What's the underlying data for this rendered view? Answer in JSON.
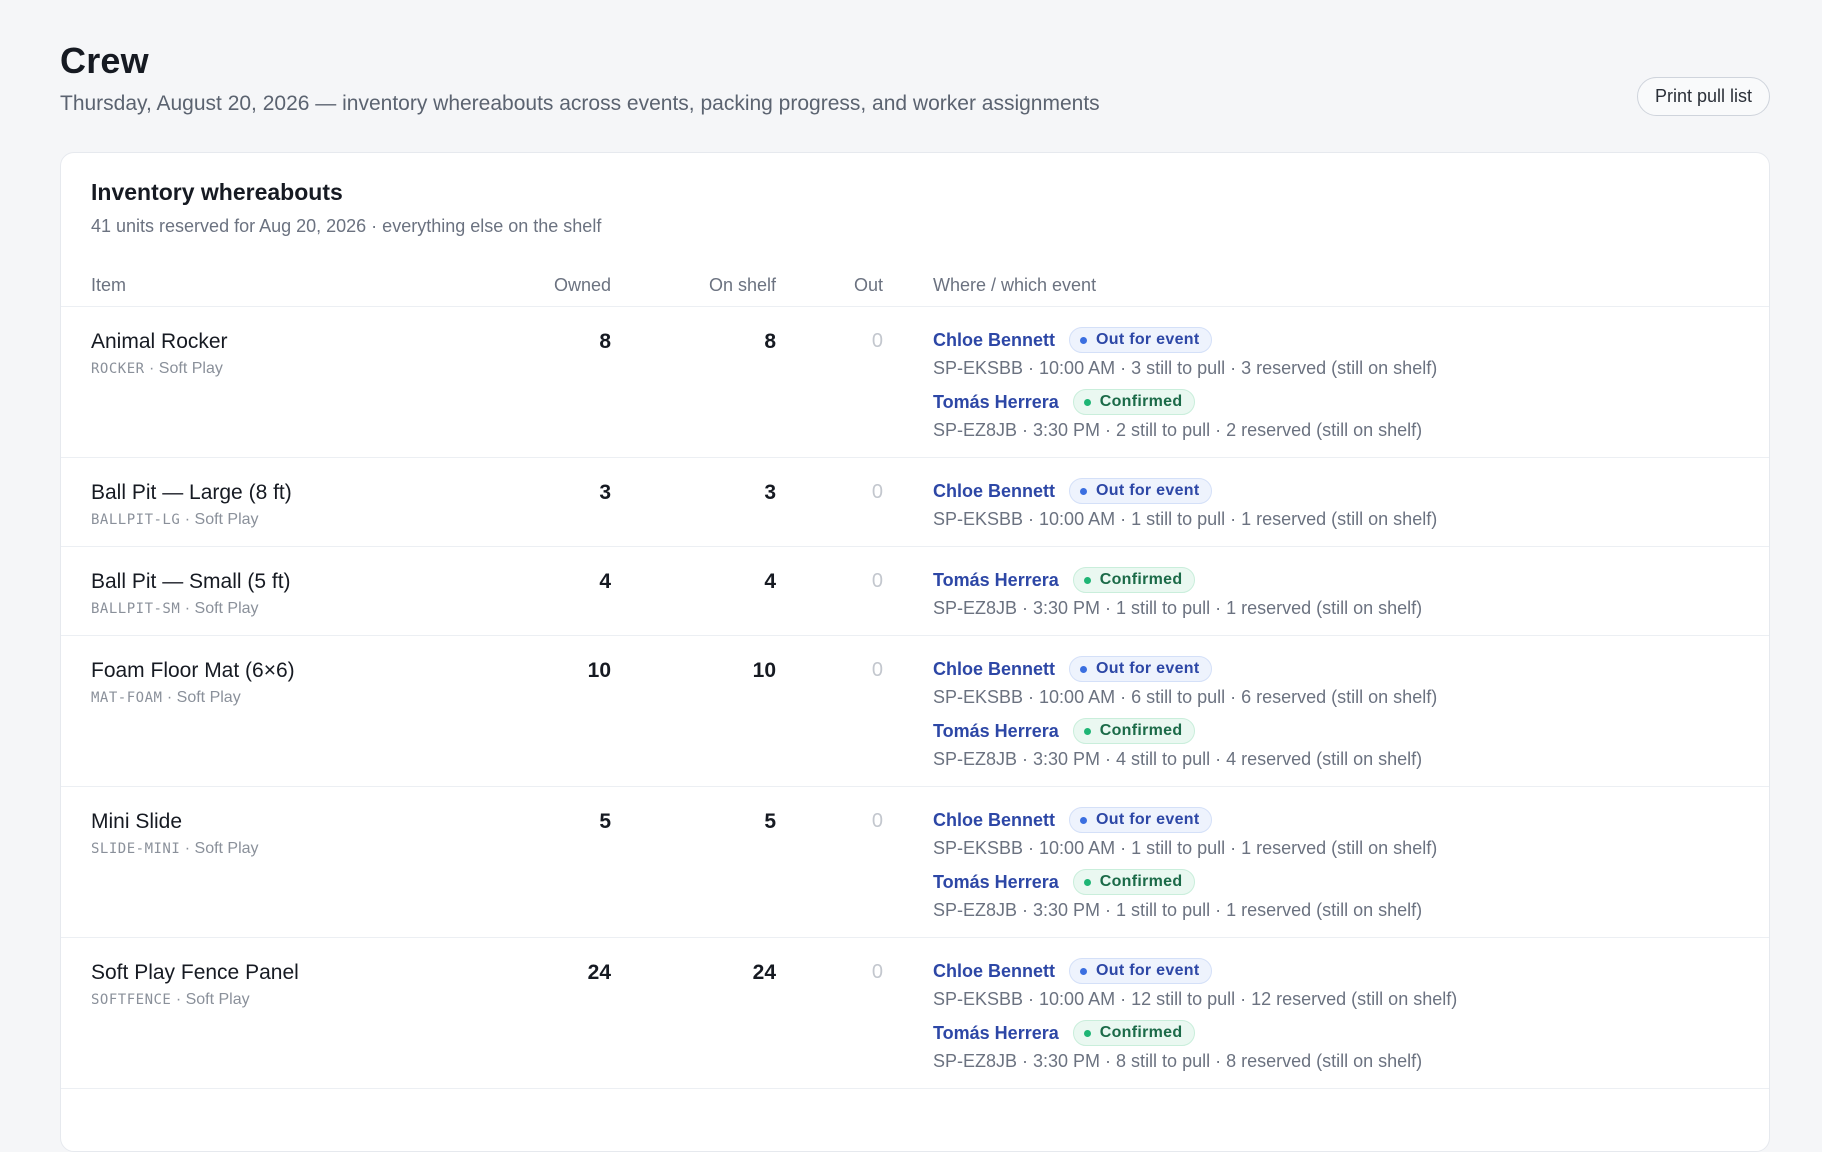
{
  "header": {
    "title": "Crew",
    "subtitle": "Thursday, August 20, 2026 — inventory whereabouts across events, packing progress, and worker assignments",
    "print_label": "Print pull list"
  },
  "card": {
    "title": "Inventory whereabouts",
    "subtitle": "41 units reserved for Aug 20, 2026 · everything else on the shelf"
  },
  "columns": {
    "item": "Item",
    "owned": "Owned",
    "on_shelf": "On shelf",
    "out": "Out",
    "where": "Where / which event"
  },
  "rows": [
    {
      "name": "Animal Rocker",
      "sku": "ROCKER",
      "category": "· Soft Play",
      "owned": "8",
      "on_shelf": "8",
      "out": "0",
      "assignments": [
        {
          "worker": "Chloe Bennett",
          "status": "Out for event",
          "status_type": "out",
          "detail": "SP-EKSBB · 10:00 AM · 3 still to pull · 3 reserved (still on shelf)"
        },
        {
          "worker": "Tomás Herrera",
          "status": "Confirmed",
          "status_type": "conf",
          "detail": "SP-EZ8JB · 3:30 PM · 2 still to pull · 2 reserved (still on shelf)"
        }
      ]
    },
    {
      "name": "Ball Pit — Large (8 ft)",
      "sku": "BALLPIT-LG",
      "category": "· Soft Play",
      "owned": "3",
      "on_shelf": "3",
      "out": "0",
      "assignments": [
        {
          "worker": "Chloe Bennett",
          "status": "Out for event",
          "status_type": "out",
          "detail": "SP-EKSBB · 10:00 AM · 1 still to pull · 1 reserved (still on shelf)"
        }
      ]
    },
    {
      "name": "Ball Pit — Small (5 ft)",
      "sku": "BALLPIT-SM",
      "category": "· Soft Play",
      "owned": "4",
      "on_shelf": "4",
      "out": "0",
      "assignments": [
        {
          "worker": "Tomás Herrera",
          "status": "Confirmed",
          "status_type": "conf",
          "detail": "SP-EZ8JB · 3:30 PM · 1 still to pull · 1 reserved (still on shelf)"
        }
      ]
    },
    {
      "name": "Foam Floor Mat (6×6)",
      "sku": "MAT-FOAM",
      "category": "· Soft Play",
      "owned": "10",
      "on_shelf": "10",
      "out": "0",
      "assignments": [
        {
          "worker": "Chloe Bennett",
          "status": "Out for event",
          "status_type": "out",
          "detail": "SP-EKSBB · 10:00 AM · 6 still to pull · 6 reserved (still on shelf)"
        },
        {
          "worker": "Tomás Herrera",
          "status": "Confirmed",
          "status_type": "conf",
          "detail": "SP-EZ8JB · 3:30 PM · 4 still to pull · 4 reserved (still on shelf)"
        }
      ]
    },
    {
      "name": "Mini Slide",
      "sku": "SLIDE-MINI",
      "category": "· Soft Play",
      "owned": "5",
      "on_shelf": "5",
      "out": "0",
      "assignments": [
        {
          "worker": "Chloe Bennett",
          "status": "Out for event",
          "status_type": "out",
          "detail": "SP-EKSBB · 10:00 AM · 1 still to pull · 1 reserved (still on shelf)"
        },
        {
          "worker": "Tomás Herrera",
          "status": "Confirmed",
          "status_type": "conf",
          "detail": "SP-EZ8JB · 3:30 PM · 1 still to pull · 1 reserved (still on shelf)"
        }
      ]
    },
    {
      "name": "Soft Play Fence Panel",
      "sku": "SOFTFENCE",
      "category": "· Soft Play",
      "owned": "24",
      "on_shelf": "24",
      "out": "0",
      "assignments": [
        {
          "worker": "Chloe Bennett",
          "status": "Out for event",
          "status_type": "out",
          "detail": "SP-EKSBB · 10:00 AM · 12 still to pull · 12 reserved (still on shelf)"
        },
        {
          "worker": "Tomás Herrera",
          "status": "Confirmed",
          "status_type": "conf",
          "detail": "SP-EZ8JB · 3:30 PM · 8 still to pull · 8 reserved (still on shelf)"
        }
      ]
    }
  ]
}
